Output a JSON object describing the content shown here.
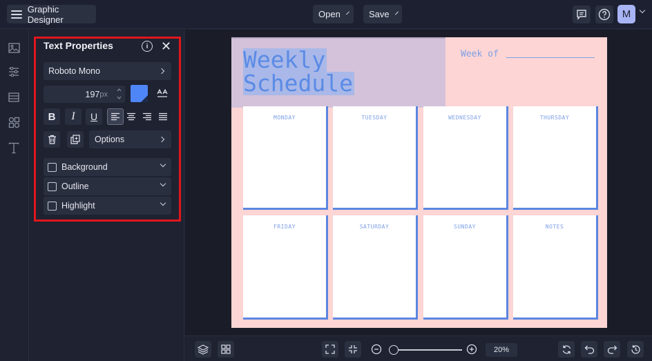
{
  "header": {
    "app_title": "Graphic Designer",
    "open_label": "Open",
    "save_label": "Save",
    "avatar_initial": "M"
  },
  "rail": {
    "items": [
      "image-icon",
      "sliders-icon",
      "layout-icon",
      "elements-icon",
      "text-icon"
    ]
  },
  "text_properties": {
    "title": "Text Properties",
    "font_name": "Roboto Mono",
    "font_size": "197",
    "font_size_unit": "px",
    "color_swatch": "#4f86f7",
    "options_label": "Options",
    "accordions": [
      {
        "label": "Background"
      },
      {
        "label": "Outline"
      },
      {
        "label": "Highlight"
      }
    ]
  },
  "canvas": {
    "title_line1": "Weekly",
    "title_line2": "Schedule",
    "week_of": "Week of",
    "days": [
      "MONDAY",
      "TUESDAY",
      "WEDNESDAY",
      "THURSDAY",
      "FRIDAY",
      "SATURDAY",
      "SUNDAY",
      "NOTES"
    ]
  },
  "footer": {
    "zoom": "20%"
  },
  "colors": {
    "accent": "#4f86f7",
    "highlight_border": "#e0161c",
    "page_background": "#fcd5d4"
  }
}
